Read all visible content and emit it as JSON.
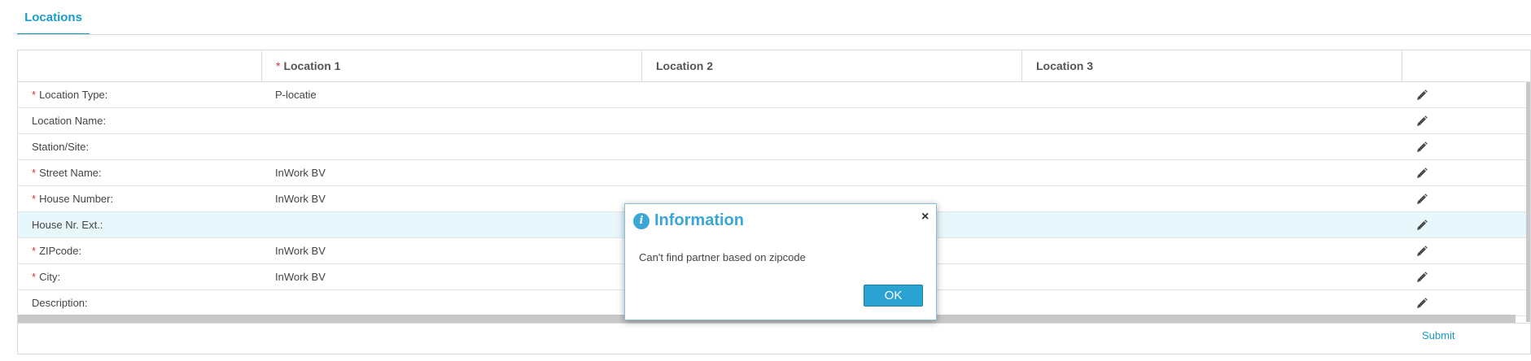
{
  "tabs": [
    {
      "label": "Locations",
      "active": true
    }
  ],
  "grid": {
    "columns": [
      {
        "label": "",
        "required": false
      },
      {
        "label": "Location 1",
        "required": true
      },
      {
        "label": "Location 2",
        "required": false
      },
      {
        "label": "Location 3",
        "required": false
      }
    ],
    "rows": [
      {
        "label": "Location Type:",
        "required": true,
        "value1": "P-locatie"
      },
      {
        "label": "Location Name:",
        "required": false,
        "value1": ""
      },
      {
        "label": "Station/Site:",
        "required": false,
        "value1": ""
      },
      {
        "label": "Street Name:",
        "required": true,
        "value1": "InWork BV"
      },
      {
        "label": "House Number:",
        "required": true,
        "value1": "InWork BV"
      },
      {
        "label": "House Nr. Ext.:",
        "required": false,
        "value1": "",
        "highlighted": true
      },
      {
        "label": "ZIPcode:",
        "required": true,
        "value1": "InWork BV"
      },
      {
        "label": "City:",
        "required": true,
        "value1": "InWork BV"
      },
      {
        "label": "Description:",
        "required": false,
        "value1": ""
      }
    ],
    "required_marker": "*",
    "edit_icon": "pencil-icon"
  },
  "footer": {
    "submit_label": "Submit"
  },
  "dialog": {
    "title": "Information",
    "icon": "info-icon",
    "icon_glyph": "i",
    "message": "Can't find partner based on zipcode",
    "ok_label": "OK",
    "close_glyph": "×"
  },
  "colors": {
    "accent": "#1a9cc9",
    "required": "#e0303a",
    "highlight_row": "#e8f7fc",
    "dialog_title": "#3aa6d6"
  }
}
